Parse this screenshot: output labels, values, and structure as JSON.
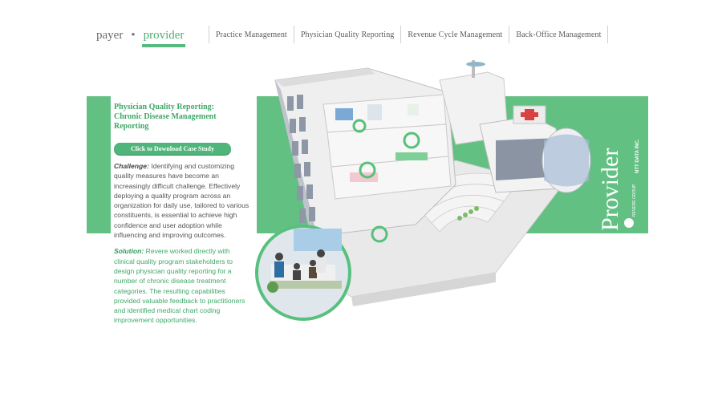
{
  "toggle": {
    "payer": "payer",
    "dot": "•",
    "provider": "provider"
  },
  "nav": {
    "items": [
      "Practice Management",
      "Physician Quality Reporting",
      "Revenue Cycle Management",
      "Back-Office Management"
    ]
  },
  "content": {
    "title_line1": "Physician Quality Reporting:",
    "title_line2": "Chronic Disease Management",
    "title_line3": "Reporting",
    "cta_label": "Click to Download Case Study",
    "challenge_label": "Challenge:",
    "challenge_text": " Identifying and customizing quality measures have become an increasingly difficult challenge. Effectively deploying a quality program across an organization for daily use, tailored to various constituents, is essential to achieve high confidence and user adoption while influencing and improving outcomes.",
    "solution_label": "Solution:",
    "solution_text": " Revere worked directly with clinical quality program stakeholders to design physician quality reporting for a number of chronic disease treatment categories. The resulting capabilities provided valuable feedback to practitioners and identified medical chart coding improvement opportunities."
  },
  "brand": {
    "provider_label": "Provider",
    "logo_text": "REVERE GROUP",
    "ntt_text": "NTT DATA INC."
  },
  "colors": {
    "accent": "#62c083",
    "accent_dark": "#3fa868",
    "text": "#555555"
  }
}
